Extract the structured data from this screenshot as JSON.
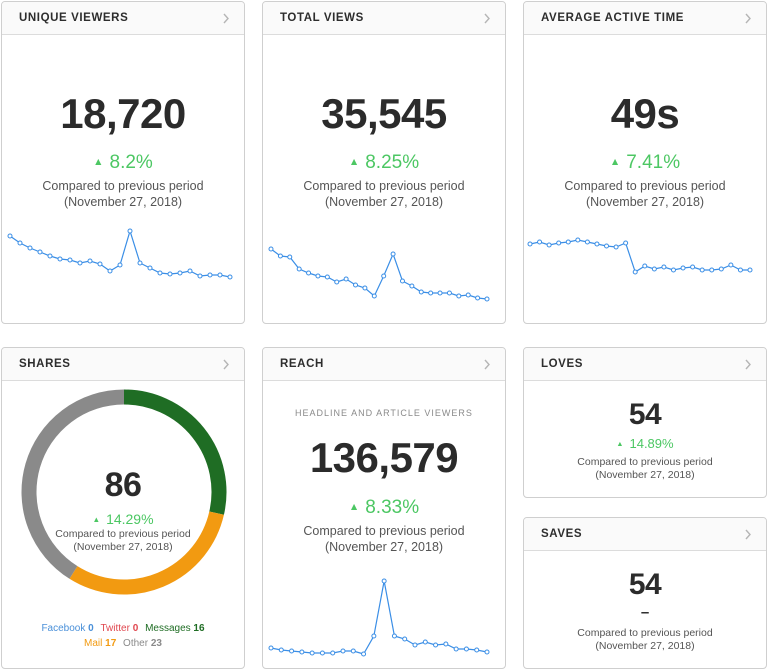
{
  "colors": {
    "accent_green": "#4cc763",
    "line_blue": "#3a8ee6",
    "facebook": "#4a90d9",
    "twitter": "#e0474f",
    "messages": "#1f6d24",
    "mail": "#f29a11",
    "other": "#8a8a8a"
  },
  "icons": {
    "chevron": "chevron-right-icon",
    "up": "triangle-up-icon"
  },
  "unique_viewers": {
    "title": "UNIQUE VIEWERS",
    "value": "18,720",
    "change": "8.2%",
    "compared": "Compared to previous period",
    "period": "(November 27, 2018)",
    "trend": [
      62,
      55,
      50,
      46,
      42,
      39,
      38,
      35,
      37,
      34,
      27,
      33,
      67,
      35,
      30,
      25,
      24,
      25,
      27,
      22,
      23,
      23,
      21
    ]
  },
  "total_views": {
    "title": "TOTAL VIEWS",
    "value": "35,545",
    "change": "8.25%",
    "compared": "Compared to previous period",
    "period": "(November 27, 2018)",
    "trend": [
      60,
      53,
      52,
      40,
      36,
      33,
      32,
      27,
      30,
      24,
      21,
      13,
      33,
      55,
      28,
      23,
      17,
      16,
      16,
      16,
      13,
      14,
      11,
      10
    ]
  },
  "average_active_time": {
    "title": "AVERAGE ACTIVE TIME",
    "value": "49s",
    "change": "7.41%",
    "compared": "Compared to previous period",
    "period": "(November 27, 2018)",
    "trend": [
      80,
      82,
      79,
      81,
      82,
      84,
      82,
      80,
      78,
      77,
      81,
      52,
      58,
      55,
      57,
      54,
      56,
      57,
      54,
      54,
      55,
      59,
      54,
      54
    ]
  },
  "shares": {
    "title": "SHARES",
    "value": "86",
    "change": "14.29%",
    "compared": "Compared to previous period",
    "period": "(November 27, 2018)",
    "breakdown": [
      {
        "name": "Facebook",
        "value": 0
      },
      {
        "name": "Twitter",
        "value": 0
      },
      {
        "name": "Messages",
        "value": 16
      },
      {
        "name": "Mail",
        "value": 17
      },
      {
        "name": "Other",
        "value": 23
      }
    ]
  },
  "reach": {
    "title": "REACH",
    "subtitle": "HEADLINE AND ARTICLE VIEWERS",
    "value": "136,579",
    "change": "8.33%",
    "compared": "Compared to previous period",
    "period": "(November 27, 2018)",
    "trend": [
      8,
      6,
      5,
      4,
      3,
      3,
      3,
      5,
      5,
      2,
      20,
      75,
      20,
      17,
      11,
      14,
      11,
      12,
      7,
      7,
      6,
      4
    ]
  },
  "loves": {
    "title": "LOVES",
    "value": "54",
    "change": "14.89%",
    "compared": "Compared to previous period",
    "period": "(November 27, 2018)"
  },
  "saves": {
    "title": "SAVES",
    "value": "54",
    "change": "–",
    "compared": "Compared to previous period",
    "period": "(November 27, 2018)"
  }
}
